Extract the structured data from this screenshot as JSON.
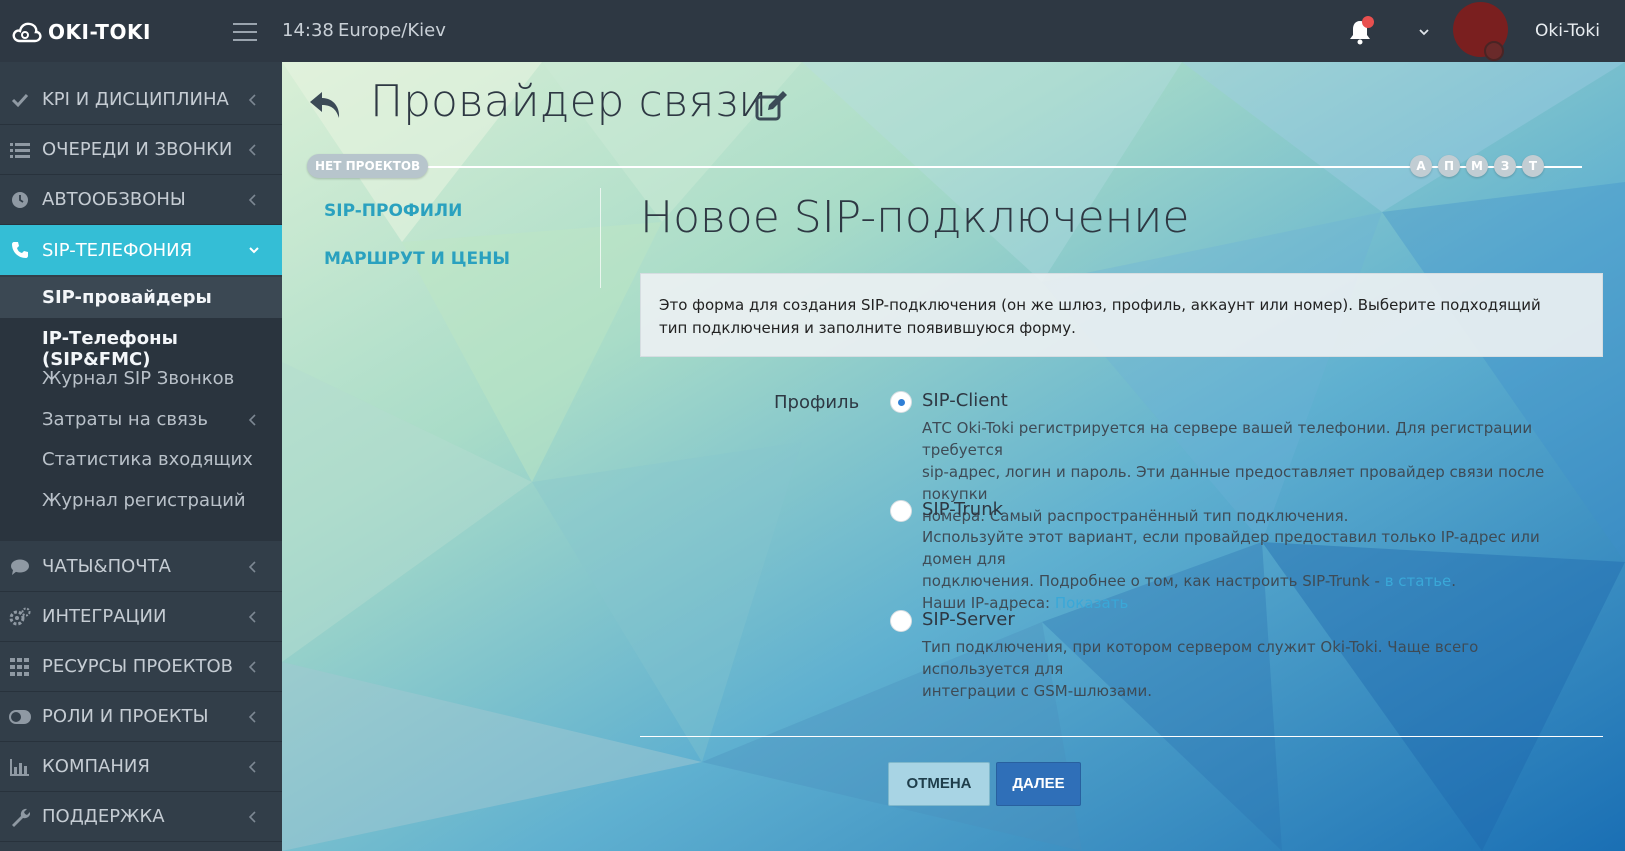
{
  "header": {
    "logo_text": "OKI-TOKI",
    "time": "14:38",
    "timezone": "Europe/Kiev",
    "username": "Oki-Toki",
    "icons": [
      "cloud-logo-icon",
      "hamburger-icon",
      "bell-icon",
      "chevron-down-icon"
    ]
  },
  "sidebar": {
    "items": [
      {
        "label": "KPI И ДИСЦИПЛИНА",
        "icon": "check-icon"
      },
      {
        "label": "ОЧЕРЕДИ И ЗВОНКИ",
        "icon": "list-icon"
      },
      {
        "label": "АВТООБЗВОНЫ",
        "icon": "clock-icon"
      },
      {
        "label": "SIP-ТЕЛЕФОНИЯ",
        "icon": "phone-icon"
      },
      {
        "label": "ЧАТЫ&ПОЧТА",
        "icon": "chat-icon"
      },
      {
        "label": "ИНТЕГРАЦИИ",
        "icon": "gears-icon"
      },
      {
        "label": "РЕСУРСЫ ПРОЕКТОВ",
        "icon": "grid-icon"
      },
      {
        "label": "РОЛИ И ПРОЕКТЫ",
        "icon": "toggle-icon"
      },
      {
        "label": "КОМПАНИЯ",
        "icon": "bar-chart-icon"
      },
      {
        "label": "ПОДДЕРЖКА",
        "icon": "wrench-icon"
      }
    ],
    "submenu": [
      {
        "label": "SIP-провайдеры"
      },
      {
        "label": "IP-Телефоны (SIP&FMC)"
      },
      {
        "label": "Журнал SIP Звонков"
      },
      {
        "label": "Затраты на связь"
      },
      {
        "label": "Статистика входящих"
      },
      {
        "label": "Журнал регистраций"
      }
    ]
  },
  "page": {
    "title": "Провайдер связи",
    "project_badge": "НЕТ ПРОЕКТОВ",
    "project_circles": [
      "А",
      "П",
      "М",
      "З",
      "Т"
    ],
    "subnav": [
      "SIP-ПРОФИЛИ",
      "МАРШРУТ И ЦЕНЫ"
    ]
  },
  "form": {
    "title": "Новое SIP-подключение",
    "info_line1": "Это форма для создания SIP-подключения (он же шлюз, профиль, аккаунт или номер). Выберите подходящий",
    "info_line2": "тип подключения и заполните появившуюся форму.",
    "field_label": "Профиль",
    "options": [
      {
        "title": "SIP-Client",
        "checked": true,
        "desc1": "АТС Oki-Toki регистрируется на сервере вашей телефонии. Для регистрации требуется",
        "desc2": "sip-адрес, логин и пароль. Эти данные предоставляет провайдер связи после покупки",
        "desc3": "номера. Самый распространённый тип подключения."
      },
      {
        "title": "SIP-Trunk",
        "checked": false,
        "desc1": "Используйте этот вариант, если провайдер предоставил только IP-адрес или домен для",
        "desc2": "подключения. Подробнее о том, как настроить SIP-Trunk - ",
        "desc2_link": "в статье",
        "desc2_end": ".",
        "desc3": "Наши IP-адреса: ",
        "desc3_link": "Показать"
      },
      {
        "title": "SIP-Server",
        "checked": false,
        "desc1": "Тип подключения, при котором сервером служит Oki-Toki. Чаще всего используется для",
        "desc2": "интеграции с GSM-шлюзами."
      }
    ],
    "cancel_label": "ОТМЕНА",
    "next_label": "ДАЛЕЕ"
  },
  "colors": {
    "topbar": "#2e3843",
    "sidebar": "#323e49",
    "active": "#34bed6",
    "link": "#2aa1bf",
    "primary_button": "#2f6fb8"
  }
}
